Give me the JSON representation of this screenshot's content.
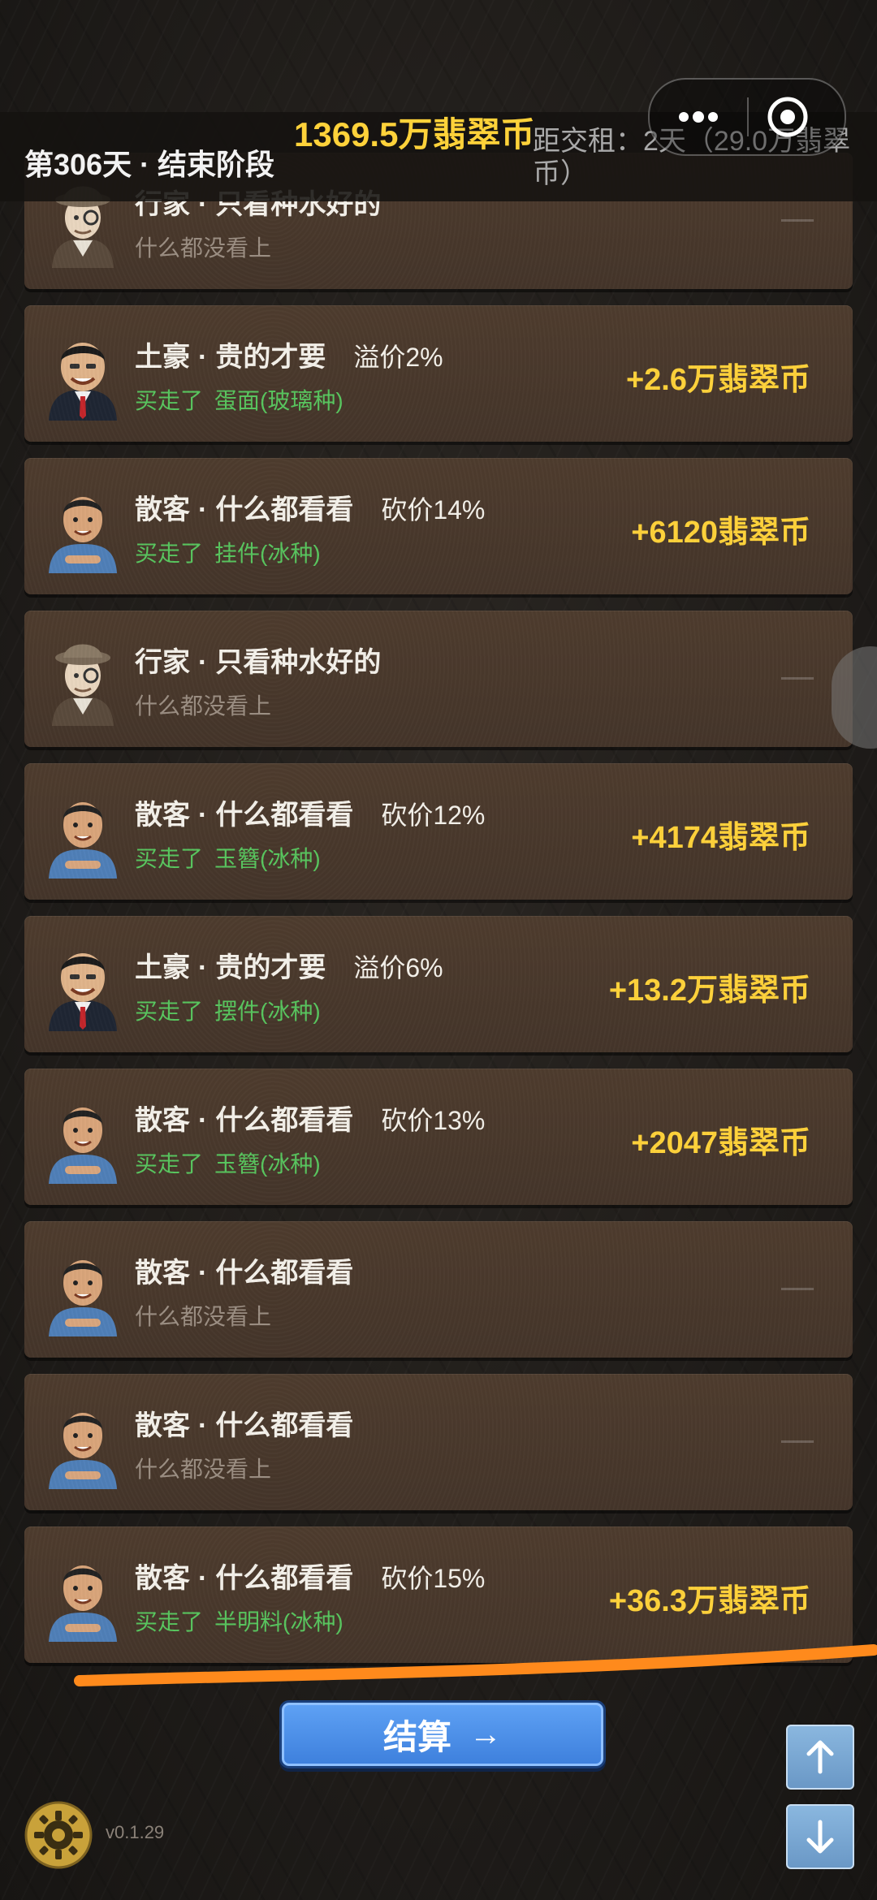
{
  "header": {
    "day": "第306天 · 结束阶段",
    "money": "1369.5万翡翠币",
    "rent": "距交租：2天（29.0万翡翠币）"
  },
  "cards": [
    {
      "type": "dealer",
      "name": "行家",
      "style": "只看种水好的",
      "modifier": "",
      "status": "none",
      "result": "什么都没看上",
      "item": "",
      "amount": ""
    },
    {
      "type": "rich",
      "name": "土豪",
      "style": "贵的才要",
      "modifier": "溢价2%",
      "status": "bought",
      "result": "买走了",
      "item": "蛋面(玻璃种)",
      "amount": "+2.6万翡翠币"
    },
    {
      "type": "casual",
      "name": "散客",
      "style": "什么都看看",
      "modifier": "砍价14%",
      "status": "bought",
      "result": "买走了",
      "item": "挂件(冰种)",
      "amount": "+6120翡翠币"
    },
    {
      "type": "dealer",
      "name": "行家",
      "style": "只看种水好的",
      "modifier": "",
      "status": "none",
      "result": "什么都没看上",
      "item": "",
      "amount": ""
    },
    {
      "type": "casual",
      "name": "散客",
      "style": "什么都看看",
      "modifier": "砍价12%",
      "status": "bought",
      "result": "买走了",
      "item": "玉簪(冰种)",
      "amount": "+4174翡翠币"
    },
    {
      "type": "rich",
      "name": "土豪",
      "style": "贵的才要",
      "modifier": "溢价6%",
      "status": "bought",
      "result": "买走了",
      "item": "摆件(冰种)",
      "amount": "+13.2万翡翠币"
    },
    {
      "type": "casual",
      "name": "散客",
      "style": "什么都看看",
      "modifier": "砍价13%",
      "status": "bought",
      "result": "买走了",
      "item": "玉簪(冰种)",
      "amount": "+2047翡翠币"
    },
    {
      "type": "casual",
      "name": "散客",
      "style": "什么都看看",
      "modifier": "",
      "status": "none",
      "result": "什么都没看上",
      "item": "",
      "amount": ""
    },
    {
      "type": "casual",
      "name": "散客",
      "style": "什么都看看",
      "modifier": "",
      "status": "none",
      "result": "什么都没看上",
      "item": "",
      "amount": ""
    },
    {
      "type": "casual",
      "name": "散客",
      "style": "什么都看看",
      "modifier": "砍价15%",
      "status": "bought",
      "result": "买走了",
      "item": "半明料(冰种)",
      "amount": "+36.3万翡翠币"
    }
  ],
  "footer": {
    "settle_label": "结算",
    "settle_arrow": "→",
    "version": "v0.1.29"
  },
  "icons": {
    "menu": "more-dots-icon",
    "close": "target-circle-icon",
    "scroll_up": "arrow-up-icon",
    "scroll_down": "arrow-down-icon",
    "settings": "gear-icon"
  },
  "colors": {
    "gold": "#ffd23a",
    "green": "#58c55e",
    "card": "#4a392c",
    "button_blue": "#4a8de6",
    "annotation_orange": "#ff8a1c"
  }
}
